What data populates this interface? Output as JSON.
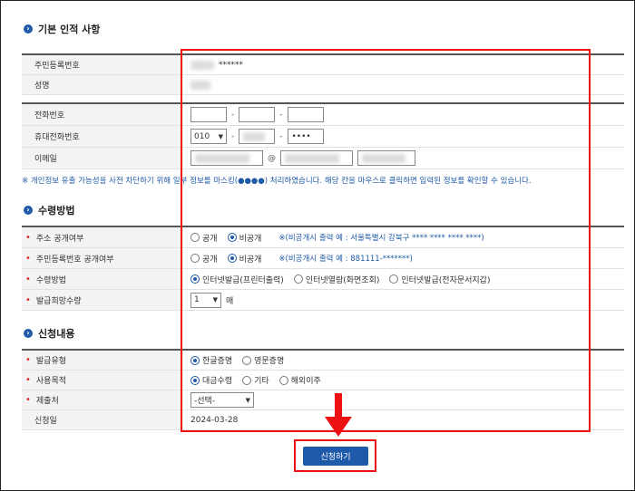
{
  "sections": {
    "basic": {
      "title": "기본 인적 사항"
    },
    "receive": {
      "title": "수령방법"
    },
    "apply": {
      "title": "신청내용"
    }
  },
  "basic": {
    "rrn_label": "주민등록번호",
    "rrn_masked": "******",
    "name_label": "성명",
    "phone_label": "전화번호",
    "mobile_label": "휴대전화번호",
    "mobile_prefix": "010",
    "mobile_last": "••••",
    "email_label": "이메일"
  },
  "notice": "※ 개인정보 유출 가능성을 사전 차단하기 위해 일부 정보를 마스킹(●●●●) 처리하였습니다. 해당 칸을 마우스로 클릭하면 입력된 정보를 확인할 수 있습니다.",
  "receive": {
    "address_label": "주소 공개여부",
    "rrn_public_label": "주민등록번호 공개여부",
    "public_option": "공개",
    "private_option": "비공개",
    "address_note": "※(비공개시 출력 예 : 서울특별시 강북구 **** **** **** ****)",
    "rrn_note": "※(비공개시 출력 예 : 881111-*******)",
    "method_label": "수령방법",
    "method_options": [
      "인터넷발급(프린터출력)",
      "인터넷열람(화면조회)",
      "인터넷발급(전자문서지갑)"
    ],
    "quantity_label": "발급희망수량",
    "quantity_value": "1",
    "quantity_unit": "매"
  },
  "apply": {
    "type_label": "발급유형",
    "type_options": [
      "한글증명",
      "영문증명"
    ],
    "purpose_label": "사용목적",
    "purpose_options": [
      "대금수령",
      "기타",
      "해외이주"
    ],
    "submit_to_label": "제출처",
    "submit_to_value": "-선택-",
    "date_label": "신청일",
    "date_value": "2024-03-28"
  },
  "submit_button": "신청하기",
  "colors": {
    "accent": "#1f5aa8",
    "highlight": "#e11111",
    "required": "#dd2222"
  }
}
